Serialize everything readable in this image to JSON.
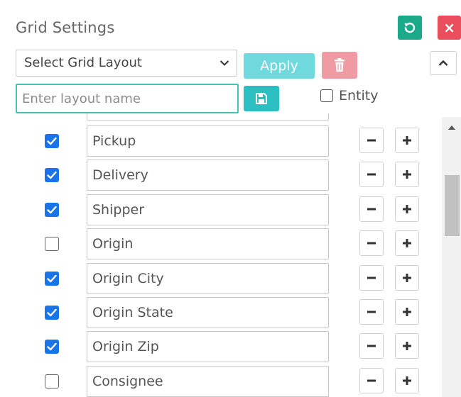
{
  "panel": {
    "title": "Grid Settings"
  },
  "header_buttons": {
    "reset_icon": "refresh-icon",
    "close_icon": "close-icon",
    "close_label": "×"
  },
  "layout": {
    "select_value": "Select Grid Layout",
    "apply_label": "Apply",
    "delete_icon": "trash-icon",
    "collapse_icon": "chevron-up-icon",
    "name_placeholder": "Enter layout name",
    "save_icon": "floppy-disk-icon",
    "entity_label": "Entity",
    "entity_checked": false
  },
  "columns": [
    {
      "label": "Pickup",
      "checked": true
    },
    {
      "label": "Delivery",
      "checked": true
    },
    {
      "label": "Shipper",
      "checked": true
    },
    {
      "label": "Origin",
      "checked": false
    },
    {
      "label": "Origin City",
      "checked": true
    },
    {
      "label": "Origin State",
      "checked": true
    },
    {
      "label": "Origin Zip",
      "checked": true
    },
    {
      "label": "Consignee",
      "checked": false
    }
  ],
  "colors": {
    "reset": "#1aaa8a",
    "close": "#ea4e5d",
    "apply": "#6fd9dd",
    "delete": "#f09aa3",
    "save": "#2bbfc1",
    "input_focus": "#48c2b7",
    "checkbox_checked": "#1a73e8"
  }
}
